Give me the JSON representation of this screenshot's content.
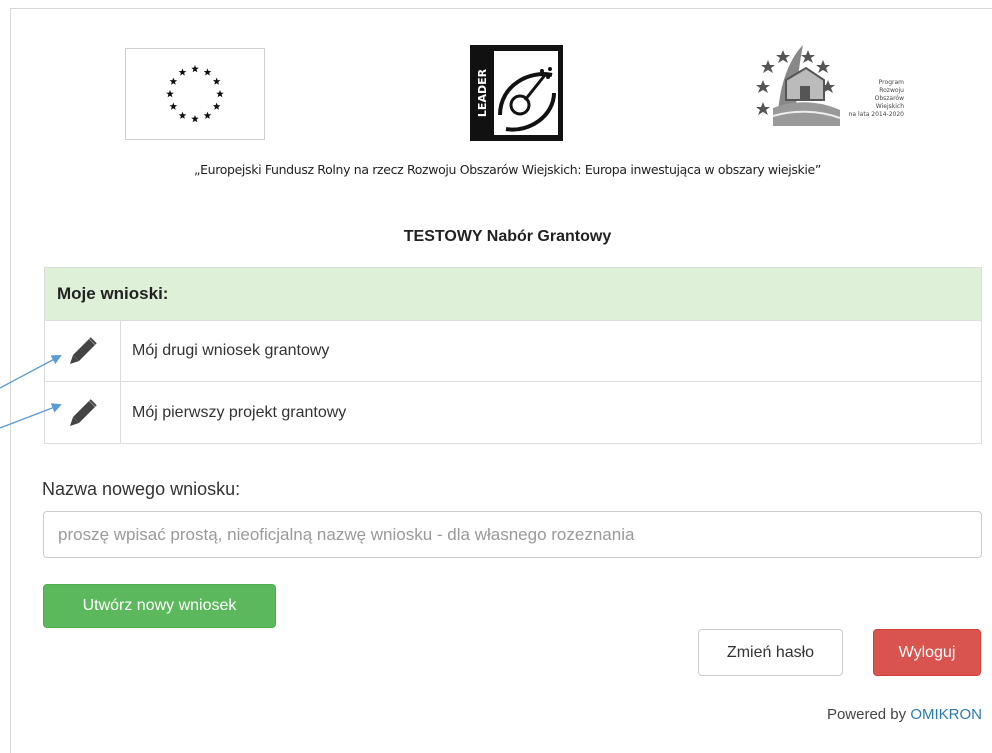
{
  "motto": "„Europejski Fundusz Rolny na rzecz Rozwoju Obszarów Wiejskich: Europa inwestująca w obszary wiejskie”",
  "page_title": "TESTOWY Nabór Grantowy",
  "logos": {
    "leader_text": "LEADER",
    "prow_lines": [
      "Program",
      "Rozwoju",
      "Obszarów",
      "Wiejskich",
      "na lata 2014-2020"
    ]
  },
  "applications": {
    "header": "Moje wnioski:",
    "rows": [
      {
        "name": "Mój drugi wniosek grantowy",
        "icon": "pencil-icon"
      },
      {
        "name": "Mój pierwszy projekt grantowy",
        "icon": "pencil-icon"
      }
    ]
  },
  "new_application": {
    "label": "Nazwa nowego wniosku:",
    "placeholder": "proszę wpisać prostą, nieoficjalną nazwę wniosku - dla własnego rozeznania",
    "value": "",
    "create_label": "Utwórz nowy wniosek"
  },
  "account": {
    "change_password_label": "Zmień hasło",
    "logout_label": "Wyloguj"
  },
  "footer": {
    "powered_prefix": "Powered by",
    "brand": "OMIKRON"
  },
  "colors": {
    "accent_green": "#5cb85c",
    "header_green": "#dff0d8",
    "danger_red": "#d9534f",
    "annotation_blue": "#5b9bd5",
    "brand_blue": "#2a7ab5"
  }
}
